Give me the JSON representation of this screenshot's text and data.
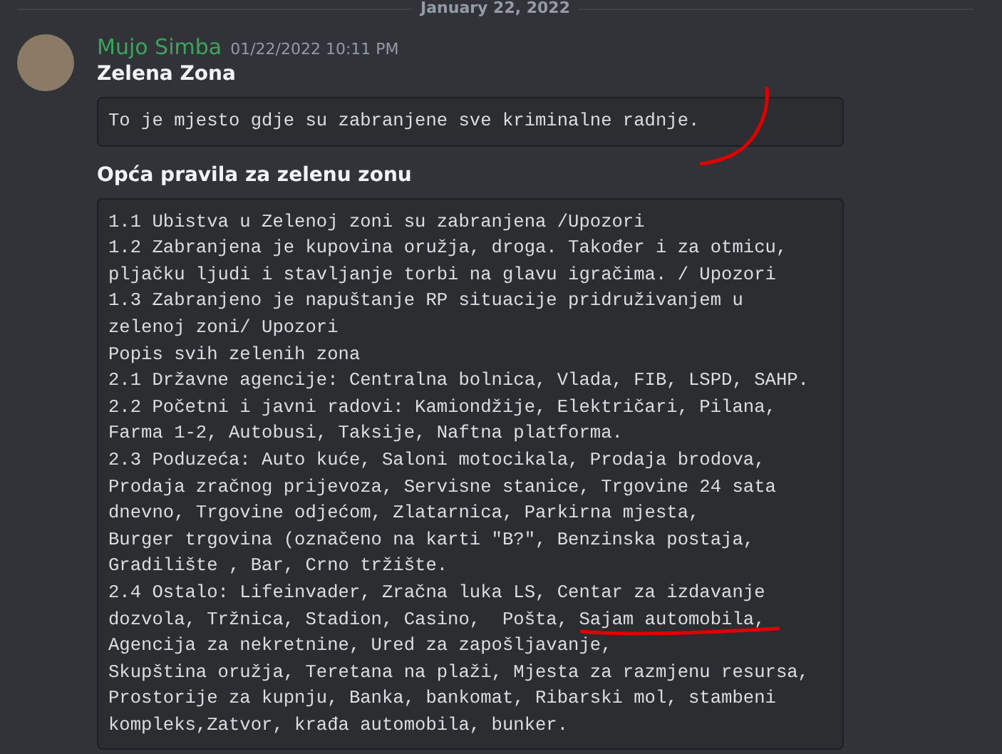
{
  "date_divider": "January 22, 2022",
  "message": {
    "author": "Mujo Simba",
    "timestamp": "01/22/2022 10:11 PM",
    "title": "Zelena Zona",
    "intro_code": "To je mjesto gdje su zabranjene sve kriminalne radnje.",
    "heading": "Opća pravila za zelenu zonu",
    "rules_code": [
      "1.1 Ubistva u Zelenoj zoni su zabranjena /Upozori",
      "1.2 Zabranjena je kupovina oružja, droga. Također i za otmicu,",
      "pljačku ljudi i stavljanje torbi na glavu igračima. / Upozori",
      "1.3 Zabranjeno je napuštanje RP situacije pridruživanjem u",
      "zelenoj zoni/ Upozori",
      "Popis svih zelenih zona",
      "2.1 Državne agencije: Centralna bolnica, Vlada, FIB, LSPD, SAHP.",
      "2.2 Početni i javni radovi: Kamiondžije, Električari, Pilana,",
      "Farma 1-2, Autobusi, Taksije, Naftna platforma.",
      "2.3 Poduzeća: Auto kuće, Saloni motocikala, Prodaja brodova,",
      "Prodaja zračnog prijevoza, Servisne stanice, Trgovine 24 sata",
      "dnevno, Trgovine odjećom, Zlatarnica, Parkirna mjesta,",
      "Burger trgovina (označeno na karti \"B?\", Benzinska postaja,",
      "Gradilište , Bar, Crno tržište.",
      "2.4 Ostalo: Lifeinvader, Zračna luka LS, Centar za izdavanje",
      "dozvola, Tržnica, Stadion, Casino,  Pošta, Sajam automobila,",
      "Agencija za nekretnine, Ured za zapošljavanje,",
      "Skupština oružja, Teretana na plaži, Mjesta za razmjenu resursa,",
      "Prostorije za kupnju, Banka, bankomat, Ribarski mol, stambeni",
      "kompleks,Zatvor, krađa automobila, bunker."
    ]
  }
}
